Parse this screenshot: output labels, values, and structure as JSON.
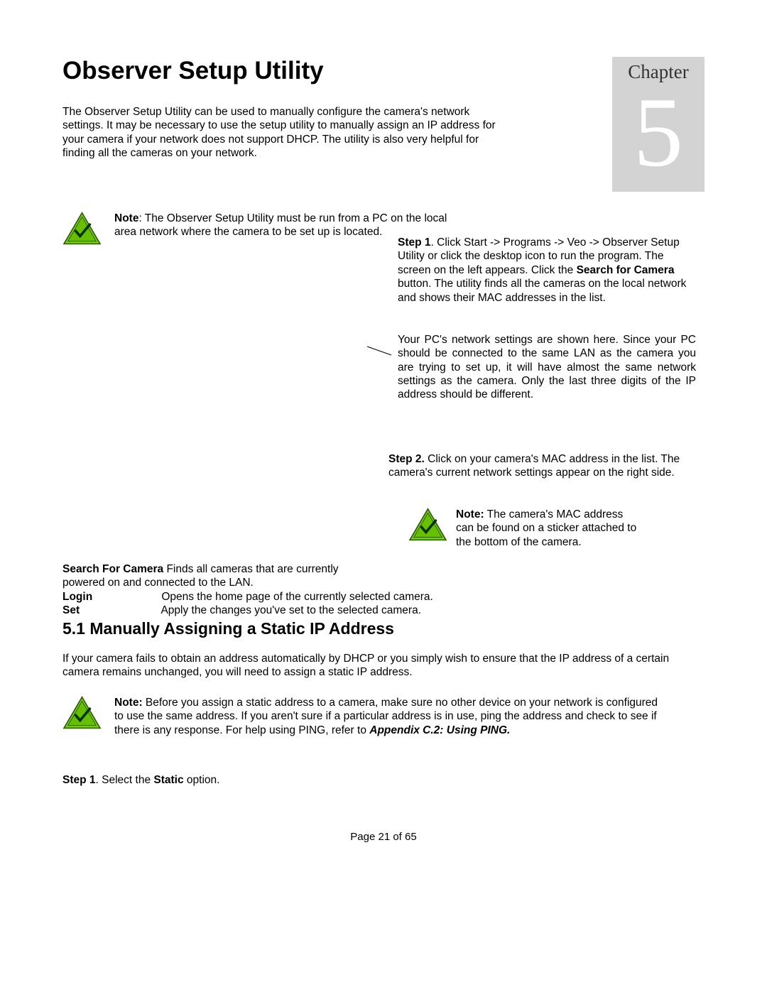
{
  "chapter": {
    "label": "Chapter",
    "number": "5"
  },
  "title": "Observer Setup Utility",
  "intro": "The Observer Setup Utility can be used to manually configure the camera's network settings. It may be necessary to use the setup utility to manually assign an IP address for your camera if your network does not support DHCP. The utility is also very helpful for finding all the cameras on your network.",
  "note1": {
    "label": "Note",
    "text": ": The Observer Setup Utility must be run from a PC on the local area network where the camera to be set up is located."
  },
  "step1": {
    "label": "Step 1",
    "part_a": ". Click Start -> Programs -> Veo -> Observer Setup Utility or click the desktop icon to run the program. The screen on the left appears. Click the ",
    "bold_mid": "Search for Camera",
    "part_b": " button. The utility finds all the cameras on the local network and shows their MAC addresses in the list."
  },
  "pc_settings": "Your PC's network settings are shown here.  Since your PC should be connected to the same LAN as the camera you are trying to set up, it will have almost the same network settings as the camera. Only the last three digits of the IP address should be different.",
  "step2": {
    "label": "Step 2.",
    "text": " Click on your camera's MAC address in the list. The camera's current network settings appear on the right side."
  },
  "note2": {
    "label": "Note:",
    "text": " The camera's MAC address can be found on a sticker attached to the bottom of the camera."
  },
  "defs": {
    "search": {
      "label": "Search For Camera",
      "text_a": "Finds all cameras that are currently",
      "text_b": "powered on and connected to the LAN."
    },
    "login": {
      "label": "Login",
      "text": "Opens the home page of the currently selected camera."
    },
    "set": {
      "label": "Set",
      "text": "Apply the changes you've set to the selected camera."
    }
  },
  "section51": {
    "heading": "5.1 Manually Assigning a Static IP Address",
    "intro": "If your camera fails to obtain an address automatically by DHCP or you simply wish to ensure that the IP address of a certain camera remains unchanged, you will need to assign a static IP address."
  },
  "note3": {
    "label": "Note:",
    "text_a": " Before you assign a static address to a camera, make sure no other device on your network is configured to use the same address. If you aren't sure if a particular address is in use, ping the address and check to see if there is any response. For help using PING, refer to ",
    "appendix": "Appendix C.2: Using PING."
  },
  "step1b": {
    "label": "Step 1",
    "text_a": ". Select the ",
    "bold": "Static",
    "text_b": " option."
  },
  "footer": "Page 21 of 65"
}
